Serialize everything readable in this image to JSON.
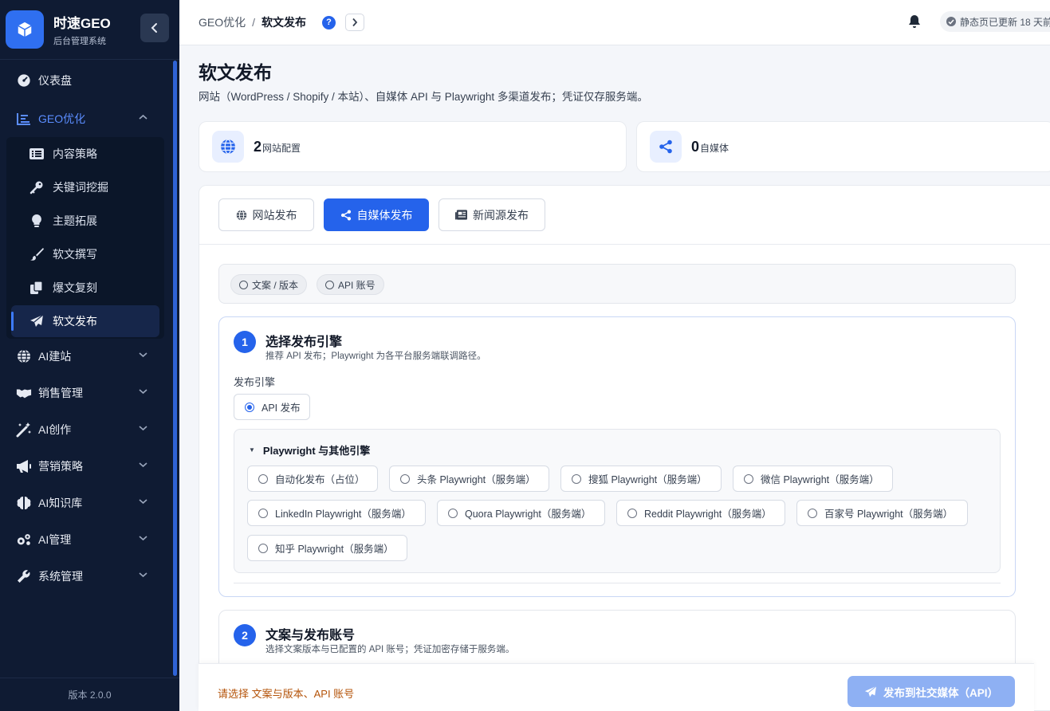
{
  "brand": {
    "name": "时速GEO",
    "subtitle": "后台管理系统"
  },
  "sidebar": {
    "items": [
      {
        "label": "仪表盘",
        "icon": "gauge-icon"
      },
      {
        "label": "GEO优化",
        "icon": "chart-bar-icon",
        "expanded": true
      },
      {
        "label": "AI建站",
        "icon": "globe-icon"
      },
      {
        "label": "销售管理",
        "icon": "handshake-icon"
      },
      {
        "label": "AI创作",
        "icon": "magic-wand-icon"
      },
      {
        "label": "营销策略",
        "icon": "megaphone-icon"
      },
      {
        "label": "AI知识库",
        "icon": "brain-icon"
      },
      {
        "label": "AI管理",
        "icon": "gears-icon"
      },
      {
        "label": "系统管理",
        "icon": "wrench-icon"
      }
    ],
    "sub_items": [
      {
        "label": "内容策略",
        "icon": "list-icon"
      },
      {
        "label": "关键词挖掘",
        "icon": "key-icon"
      },
      {
        "label": "主题拓展",
        "icon": "lightbulb-icon"
      },
      {
        "label": "软文撰写",
        "icon": "brush-icon"
      },
      {
        "label": "爆文复刻",
        "icon": "copy-icon"
      },
      {
        "label": "软文发布",
        "icon": "paper-plane-icon",
        "active": true
      }
    ],
    "version": "版本 2.0.0"
  },
  "header": {
    "breadcrumb": [
      "GEO优化",
      "软文发布"
    ],
    "breadcrumb_sep": "/",
    "help": "?",
    "status": "静态页已更新 18 天前"
  },
  "page": {
    "title": "软文发布",
    "description": "网站（WordPress / Shopify / 本站）、自媒体 API 与 Playwright 多渠道发布；凭证仅存服务端。"
  },
  "stats": [
    {
      "value": "2",
      "label": "网站配置",
      "icon": "globe-icon"
    },
    {
      "value": "0",
      "label": "自媒体",
      "icon": "share-icon"
    }
  ],
  "tabs": [
    {
      "label": "网站发布",
      "icon": "globe-icon"
    },
    {
      "label": "自媒体发布",
      "icon": "share-icon",
      "active": true
    },
    {
      "label": "新闻源发布",
      "icon": "newspaper-icon"
    }
  ],
  "steps": [
    "文案 / 版本",
    "API 账号"
  ],
  "section1": {
    "number": "1",
    "title": "选择发布引擎",
    "description": "推荐 API 发布；Playwright 为各平台服务端联调路径。",
    "field_label": "发布引擎",
    "primary_option": "API 发布",
    "group_title": "Playwright 与其他引擎",
    "options": [
      "自动化发布（占位）",
      "头条 Playwright（服务端）",
      "搜狐 Playwright（服务端）",
      "微信 Playwright（服务端）",
      "LinkedIn Playwright（服务端）",
      "Quora Playwright（服务端）",
      "Reddit Playwright（服务端）",
      "百家号 Playwright（服务端）",
      "知乎 Playwright（服务端）"
    ]
  },
  "section2": {
    "number": "2",
    "title": "文案与发布账号",
    "description": "选择文案版本与已配置的 API 账号；凭证加密存储于服务端。"
  },
  "footer": {
    "message": "请选择 文案与版本、API 账号",
    "publish_label": "发布到社交媒体（API）"
  },
  "colors": {
    "sidebar_bg": "#0f1b33",
    "accent": "#2563eb",
    "warning_text": "#b45309"
  }
}
